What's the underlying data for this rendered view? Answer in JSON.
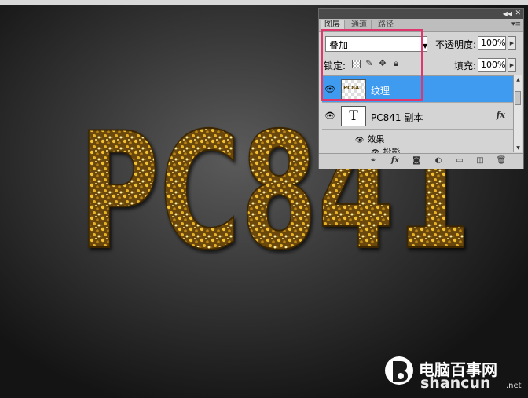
{
  "canvas": {
    "artwork_text": "PC841",
    "colors": {
      "background_center": "#5b5b5b",
      "background_edge": "#141414",
      "gold_light": "#f2c230",
      "gold_dark": "#5a3c06",
      "highlight": "#e0366e"
    }
  },
  "layers_panel": {
    "tabs": [
      {
        "label": "图层",
        "active": true
      },
      {
        "label": "通道",
        "active": false
      },
      {
        "label": "路径",
        "active": false
      }
    ],
    "blend_mode": "叠加",
    "opacity_label": "不透明度:",
    "opacity_value": "100%",
    "lock_label": "锁定:",
    "fill_label": "填充:",
    "fill_value": "100%",
    "layers": [
      {
        "name": "纹理",
        "selected": true,
        "visible": true,
        "thumb_text": "PC841"
      },
      {
        "name": "PC841 副本",
        "selected": false,
        "visible": true,
        "thumb_glyph": "T",
        "fx": "fx"
      }
    ],
    "effects_label": "效果",
    "effect_items": [
      "投影"
    ],
    "selection_color": "#3f9bf0"
  },
  "watermark": {
    "cn": "电脑百事网",
    "en": "shancun",
    "tld": ".net"
  }
}
